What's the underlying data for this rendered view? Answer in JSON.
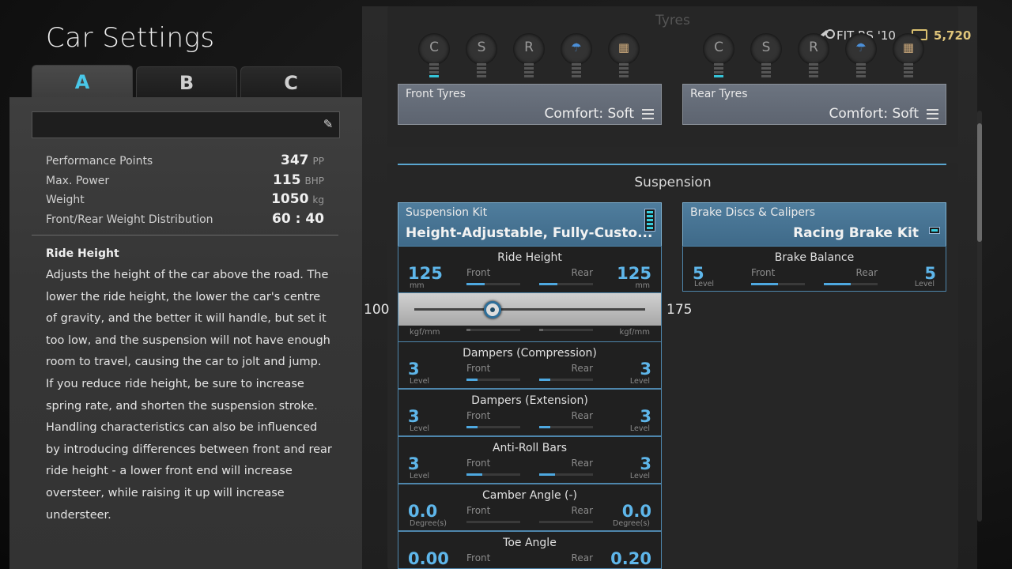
{
  "page_title": "Car Settings",
  "tabs": [
    {
      "label": "A"
    },
    {
      "label": "B"
    },
    {
      "label": "C"
    }
  ],
  "name_field": {
    "value": ""
  },
  "stats": [
    {
      "label": "Performance Points",
      "value": "347",
      "unit": "PP"
    },
    {
      "label": "Max. Power",
      "value": "115",
      "unit": "BHP"
    },
    {
      "label": "Weight",
      "value": "1050",
      "unit": "kg"
    },
    {
      "label": "Front/Rear Weight Distribution",
      "value": "60 : 40",
      "unit": ""
    }
  ],
  "description": {
    "title": "Ride Height",
    "text": "Adjusts the height of the car above the road. The lower the ride height, the lower the car's centre of gravity, and the better it will handle, but set it too low, and the suspension will not have enough room to travel, causing the car to jolt and jump. If you reduce ride height, be sure to increase spring rate, and shorten the suspension stroke. Handling characteristics can also be influenced by introducing differences between front and rear ride height -  a lower front end will increase oversteer, while raising it up will increase understeer."
  },
  "header": {
    "car": "FIT RS '10",
    "credits": "5,720"
  },
  "tyres": {
    "heading": "Tyres",
    "selectors": [
      {
        "label": "C"
      },
      {
        "label": "S"
      },
      {
        "label": "R"
      },
      {
        "label": "rain-icon"
      },
      {
        "label": "dirt-icon"
      }
    ],
    "front": {
      "label": "Front Tyres",
      "value": "Comfort: Soft"
    },
    "rear": {
      "label": "Rear Tyres",
      "value": "Comfort: Soft"
    }
  },
  "suspension": {
    "heading": "Suspension",
    "kit": {
      "label": "Suspension Kit",
      "value": "Height-Adjustable, Fully-Custo..."
    },
    "brake": {
      "label": "Brake Discs & Calipers",
      "value": "Racing Brake Kit"
    },
    "brake_balance": {
      "title": "Brake Balance",
      "front": "5",
      "rear": "5",
      "unit": "Level",
      "front_label": "Front",
      "rear_label": "Rear",
      "front_fill": 0.5,
      "rear_fill": 0.5
    },
    "slider": {
      "min": "100",
      "max": "175",
      "value_fraction": 0.34,
      "unit_left": "kgf/mm",
      "unit_right": "kgf/mm"
    },
    "rows": [
      {
        "title": "Ride Height",
        "front": "125",
        "rear": "125",
        "unit": "mm",
        "front_label": "Front",
        "rear_label": "Rear",
        "front_fill": 0.34,
        "rear_fill": 0.34
      },
      {
        "title": "Dampers (Compression)",
        "front": "3",
        "rear": "3",
        "unit": "Level",
        "front_label": "Front",
        "rear_label": "Rear",
        "front_fill": 0.2,
        "rear_fill": 0.2
      },
      {
        "title": "Dampers (Extension)",
        "front": "3",
        "rear": "3",
        "unit": "Level",
        "front_label": "Front",
        "rear_label": "Rear",
        "front_fill": 0.2,
        "rear_fill": 0.2
      },
      {
        "title": "Anti-Roll Bars",
        "front": "3",
        "rear": "3",
        "unit": "Level",
        "front_label": "Front",
        "rear_label": "Rear",
        "front_fill": 0.3,
        "rear_fill": 0.3
      },
      {
        "title": "Camber Angle (-)",
        "front": "0.0",
        "rear": "0.0",
        "unit": "Degree(s)",
        "front_label": "Front",
        "rear_label": "Rear",
        "front_fill": 0,
        "rear_fill": 0
      },
      {
        "title": "Toe Angle",
        "front": "0.00",
        "rear": "0.20",
        "unit": "",
        "front_label": "Front",
        "rear_label": "Rear",
        "front_fill": 0,
        "rear_fill": 0
      }
    ]
  },
  "colors": {
    "accent": "#49c7e8",
    "value_blue": "#5eb6ea",
    "credits": "#e0c57a"
  }
}
